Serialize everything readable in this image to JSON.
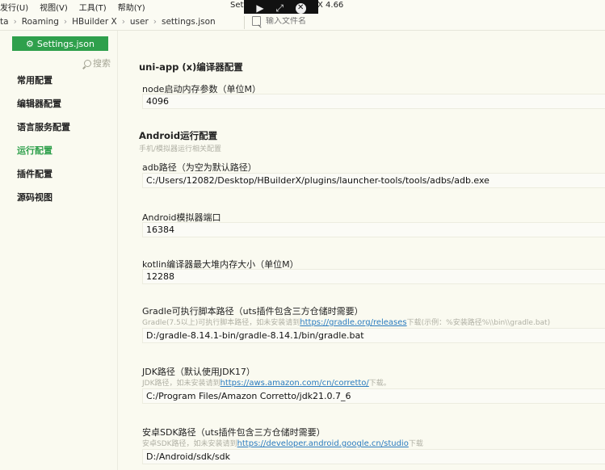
{
  "menubar": {
    "items": [
      "发行(U)",
      "视图(V)",
      "工具(T)",
      "帮助(Y)"
    ],
    "window_title_left": "Sett",
    "window_title_right": "X 4.66"
  },
  "overlay": {
    "icons": [
      "play-icon",
      "expand-icon",
      "close-icon"
    ]
  },
  "breadcrumb": [
    "ta",
    "Roaming",
    "HBuilder X",
    "user",
    "settings.json"
  ],
  "file_search": {
    "placeholder": "输入文件名"
  },
  "sidebar": {
    "tab_label": "Settings.json",
    "search_label": "搜索",
    "items": [
      "常用配置",
      "编辑器配置",
      "语言服务配置",
      "运行配置",
      "插件配置",
      "源码视图"
    ],
    "active_index": 3
  },
  "main": {
    "section1_title": "uni-app (x)编译器配置",
    "node_label": "node启动内存参数（单位M）",
    "node_value": "4096",
    "section2_title": "Android运行配置",
    "section2_sub": "手机/模拟器运行相关配置",
    "adb_label": "adb路径（为空为默认路径）",
    "adb_value": "C:/Users/12082/Desktop/HBuilderX/plugins/launcher-tools/tools/adbs/adb.exe",
    "emulator_label": "Android模拟器端口",
    "emulator_value": "16384",
    "kotlin_label": "kotlin编译器最大堆内存大小（单位M）",
    "kotlin_value": "12288",
    "gradle_label": "Gradle可执行脚本路径（uts插件包含三方仓储时需要）",
    "gradle_hint_pre": "Gradle(7.5以上)可执行脚本路径，如未安装请到",
    "gradle_hint_link": "https://gradle.org/releases",
    "gradle_hint_post": "下载(示例：%安装路径%\\\\bin\\\\gradle.bat)",
    "gradle_value": "D:/gradle-8.14.1-bin/gradle-8.14.1/bin/gradle.bat",
    "jdk_label": "JDK路径（默认使用JDK17）",
    "jdk_hint_pre": "JDK路径，如未安装请到",
    "jdk_hint_link": "https://aws.amazon.com/cn/corretto/",
    "jdk_hint_post": "下载。",
    "jdk_value": "C:/Program Files/Amazon Corretto/jdk21.0.7_6",
    "sdk_label": "安卓SDK路径（uts插件包含三方仓储时需要）",
    "sdk_hint_pre": "安卓SDK路径，如未安装请到",
    "sdk_hint_link": "https://developer.android.google.cn/studio",
    "sdk_hint_post": "下载",
    "sdk_value": "D:/Android/sdk/sdk"
  }
}
